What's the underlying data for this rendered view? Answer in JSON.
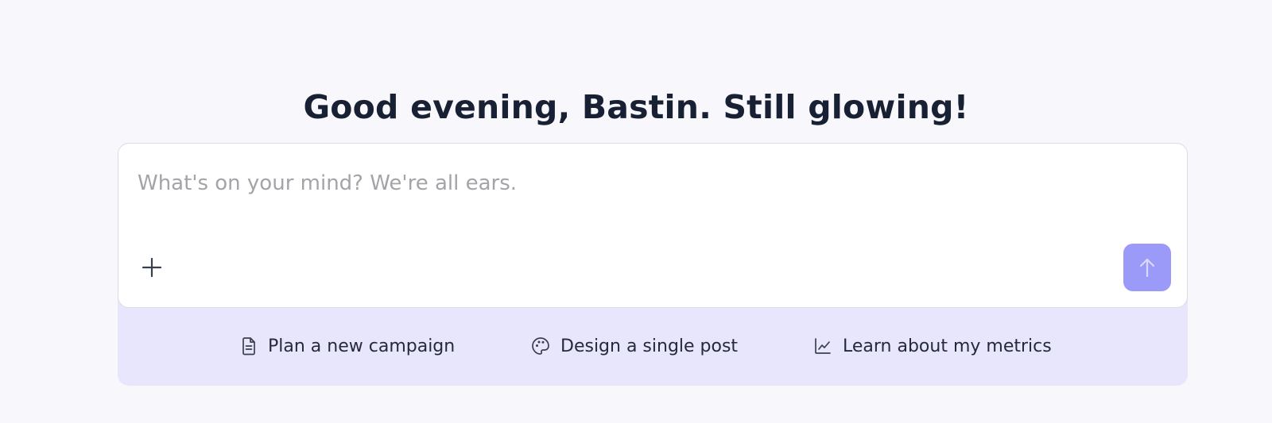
{
  "header": {
    "greeting": "Good evening, Bastin. Still glowing!"
  },
  "composer": {
    "placeholder": "What's on your mind? We're all ears.",
    "value": "",
    "add_icon": "plus-icon",
    "send_icon": "arrow-up-icon"
  },
  "suggestions": [
    {
      "label": "Plan a new campaign",
      "icon": "document-icon"
    },
    {
      "label": "Design a single post",
      "icon": "palette-icon"
    },
    {
      "label": "Learn about my metrics",
      "icon": "line-chart-icon"
    }
  ],
  "colors": {
    "background": "#f7f7fc",
    "accent": "#9b9af8",
    "suggestion_bar": "#e8e6fd",
    "heading": "#182033"
  }
}
